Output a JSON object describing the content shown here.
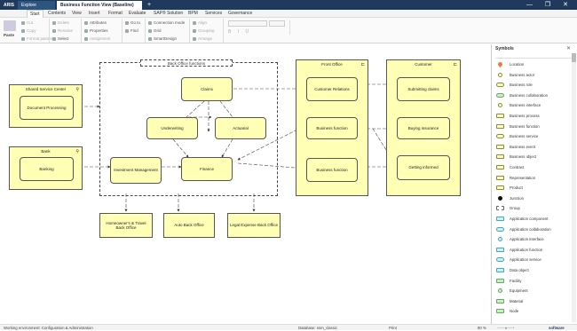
{
  "titlebar": {
    "app": "ARIS",
    "tabs": [
      "Explore",
      "Business Function View (Baseline)"
    ],
    "add": "+",
    "window_controls": "—  ❐  ✕"
  },
  "menu": [
    "Start",
    "Contents",
    "View",
    "Insert",
    "Format",
    "Evaluate",
    "SAP® Solution",
    "BPM",
    "Services",
    "Governance"
  ],
  "ribbon": {
    "paste": "Paste",
    "clipboard": [
      "Cut",
      "Copy",
      "Format painter"
    ],
    "edit": [
      "Delete",
      "Rename",
      "Select"
    ],
    "properties": [
      "Attributes",
      "Properties",
      "Assignment"
    ],
    "find": [
      "Go to",
      "Find"
    ],
    "layout": [
      "Connection mode",
      "Grid",
      "SmartDesign"
    ],
    "arrange": [
      "Align",
      "Grouping",
      "Arrange"
    ]
  },
  "symbols": {
    "title": "Symbols",
    "items": [
      {
        "label": "Location",
        "icon": "location-icon"
      },
      {
        "label": "Business actor",
        "icon": "actor-icon"
      },
      {
        "label": "Business role",
        "icon": "role-icon"
      },
      {
        "label": "Business collaboration",
        "icon": "collaboration-icon"
      },
      {
        "label": "Business interface",
        "icon": "interface-icon"
      },
      {
        "label": "Business process",
        "icon": "process-icon"
      },
      {
        "label": "Business function",
        "icon": "function-icon"
      },
      {
        "label": "Business service",
        "icon": "service-icon"
      },
      {
        "label": "Business event",
        "icon": "event-icon"
      },
      {
        "label": "Business object",
        "icon": "object-icon"
      },
      {
        "label": "Contract",
        "icon": "contract-icon"
      },
      {
        "label": "Representation",
        "icon": "representation-icon"
      },
      {
        "label": "Product",
        "icon": "product-icon"
      },
      {
        "label": "Junction",
        "icon": "junction-icon"
      },
      {
        "label": "Group",
        "icon": "group-icon"
      },
      {
        "label": "Application component",
        "icon": "app-component-icon"
      },
      {
        "label": "Application collaboration",
        "icon": "app-collaboration-icon"
      },
      {
        "label": "Application interface",
        "icon": "app-interface-icon"
      },
      {
        "label": "Application function",
        "icon": "app-function-icon"
      },
      {
        "label": "Application service",
        "icon": "app-service-icon"
      },
      {
        "label": "Data object",
        "icon": "data-object-icon"
      },
      {
        "label": "Facility",
        "icon": "facility-icon"
      },
      {
        "label": "Equipment",
        "icon": "equipment-icon"
      },
      {
        "label": "Material",
        "icon": "material-icon"
      },
      {
        "label": "Node",
        "icon": "node-icon"
      }
    ]
  },
  "diagram": {
    "groups": {
      "back_office": "Back Office functions",
      "front_office": "Front Office",
      "customer": "Customer",
      "shared_service": "Shared Service Center",
      "bank": "Bank"
    },
    "nodes": {
      "claims": "Claims",
      "underwriting": "Underwriting",
      "actuarial": "Actuarial",
      "finance": "Finance",
      "investment": "Investment Management",
      "doc_processing": "Document Processing",
      "banking": "Banking",
      "customer_relations": "Customer Relations",
      "bf1": "Business function",
      "bf2": "Business function",
      "submitting": "Submitting claims",
      "buying": "Buying insurance",
      "informed": "Getting informed",
      "homeowners": "Homeowner's & Travel Back Office",
      "auto": "Auto Back Office",
      "legal": "Legal Expense Back Office"
    }
  },
  "status": {
    "left": "Working environment: Configuration & Administration",
    "database": "Database: ssm_classic",
    "print": "Print",
    "zoom": "90 %",
    "brand": "software"
  },
  "colors": {
    "titlebar": "#1f3a5c",
    "node_fill": "#ffffb5",
    "accent": "#2d5580"
  }
}
